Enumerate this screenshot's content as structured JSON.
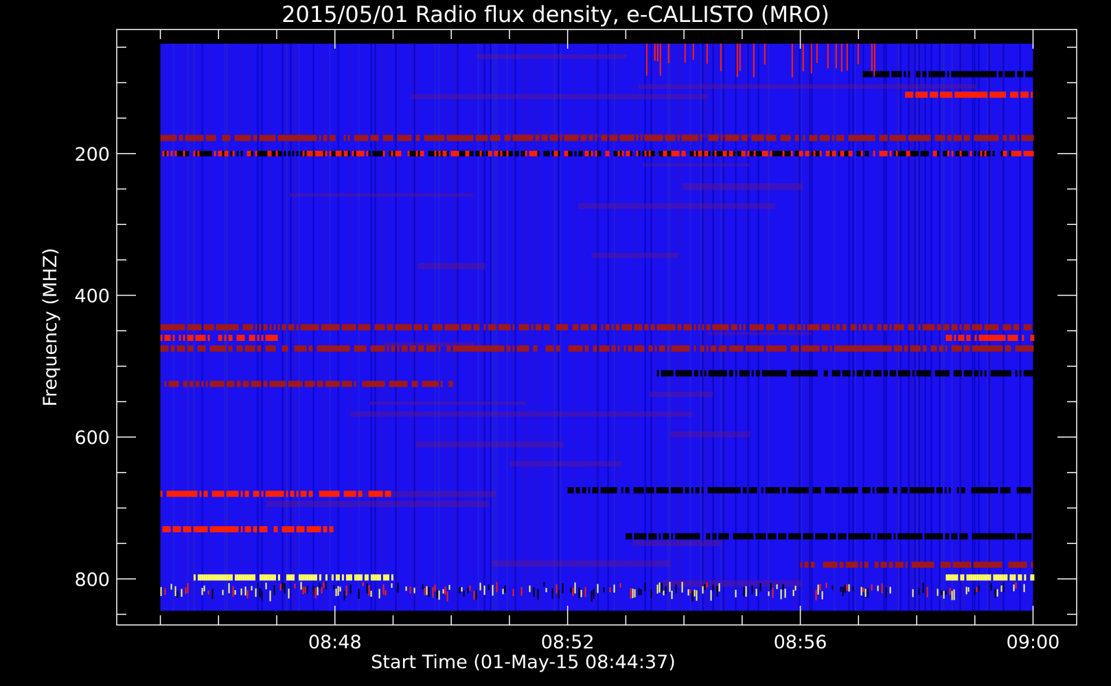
{
  "chart_data": {
    "type": "heatmap",
    "title": "2015/05/01  Radio flux density, e-CALLISTO (MRO)",
    "xlabel": "Start Time (01-May-15 08:44:37)",
    "ylabel": "Frequency (MHZ)",
    "x_tick_labels": [
      "08:48",
      "08:52",
      "08:56",
      "09:00"
    ],
    "x_ticks_minutes_from_0848": [
      0,
      4,
      8,
      12
    ],
    "x_data_range_minutes_from_0848": [
      -3.0,
      12.0
    ],
    "x_axis_range_minutes_from_0848": [
      -3.75,
      12.75
    ],
    "y_tick_labels": [
      "200",
      "400",
      "600",
      "800"
    ],
    "y_ticks": [
      200,
      400,
      600,
      800
    ],
    "y_minor_step": 50,
    "y_data_range": [
      45,
      845
    ],
    "y_axis_range": [
      25,
      865
    ],
    "y_inverted": true,
    "colormap": [
      "#000000",
      "#0000ff",
      "#a01818",
      "#ff2000",
      "#ffff60"
    ],
    "background_color": "#1a10f0",
    "bands": [
      {
        "freq": 60,
        "level": 3,
        "t_start": 5.3,
        "t_end": 9.5,
        "note": "vertical red spikes near top"
      },
      {
        "freq": 88,
        "level": 0,
        "t_start": 9.0,
        "t_end": 12.0
      },
      {
        "freq": 117,
        "level": 3,
        "t_start": 9.8,
        "t_end": 12.0
      },
      {
        "freq": 178,
        "level": 2,
        "t_start": -3.0,
        "t_end": 12.0
      },
      {
        "freq": 200,
        "level": 0.5,
        "t_start": -3.0,
        "t_end": 12.0
      },
      {
        "freq": 445,
        "level": 2,
        "t_start": -3.0,
        "t_end": 12.0
      },
      {
        "freq": 460,
        "level": 3,
        "t_start": -3.0,
        "t_end": -1.0
      },
      {
        "freq": 460,
        "level": 3,
        "t_start": 10.5,
        "t_end": 12.0
      },
      {
        "freq": 475,
        "level": 2,
        "t_start": -3.0,
        "t_end": 12.0
      },
      {
        "freq": 510,
        "level": 0,
        "t_start": 5.5,
        "t_end": 12.0
      },
      {
        "freq": 525,
        "level": 2,
        "t_start": -3.0,
        "t_end": 2.0
      },
      {
        "freq": 675,
        "level": 0,
        "t_start": 4.0,
        "t_end": 12.0
      },
      {
        "freq": 680,
        "level": 3,
        "t_start": -3.0,
        "t_end": 1.0
      },
      {
        "freq": 730,
        "level": 3,
        "t_start": -3.0,
        "t_end": 0.0
      },
      {
        "freq": 740,
        "level": 0,
        "t_start": 5.0,
        "t_end": 12.0
      },
      {
        "freq": 780,
        "level": 2,
        "t_start": 8.0,
        "t_end": 12.0
      },
      {
        "freq": 798,
        "level": 4,
        "t_start": -2.5,
        "t_end": 1.0
      },
      {
        "freq": 798,
        "level": 4,
        "t_start": 10.5,
        "t_end": 12.0
      },
      {
        "freq": 810,
        "level": 4,
        "t_start": -3.0,
        "t_end": 12.0,
        "note": "intermittent yellow/red dashes"
      }
    ]
  }
}
